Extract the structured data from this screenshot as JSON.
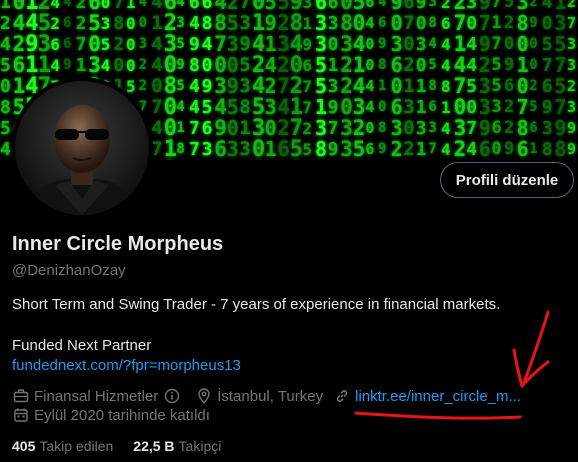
{
  "profile": {
    "display_name": "Inner Circle Morpheus",
    "handle": "@DenizhanOzay",
    "bio": "Short Term and Swing Trader - 7 years of experience in financial markets.",
    "partner_line": "Funded Next Partner",
    "partner_link": "fundednext.com/?fpr=morpheus13",
    "edit_button": "Profili düzenle"
  },
  "meta": {
    "category": "Finansal Hizmetler",
    "location": "İstanbul, Turkey",
    "website": "linktr.ee/inner_circle_m...",
    "joined": "Eylül 2020 tarihinde katıldı"
  },
  "stats": {
    "following_count": "405",
    "following_label": "Takip edilen",
    "followers_count": "22,5 B",
    "followers_label": "Takipçi"
  },
  "colors": {
    "accent": "#1d9bf0",
    "matrix_green": "#22ff22",
    "annotation_red": "#e8141a"
  },
  "icons": [
    "briefcase-icon",
    "info-icon",
    "location-pin-icon",
    "link-icon",
    "calendar-icon"
  ]
}
